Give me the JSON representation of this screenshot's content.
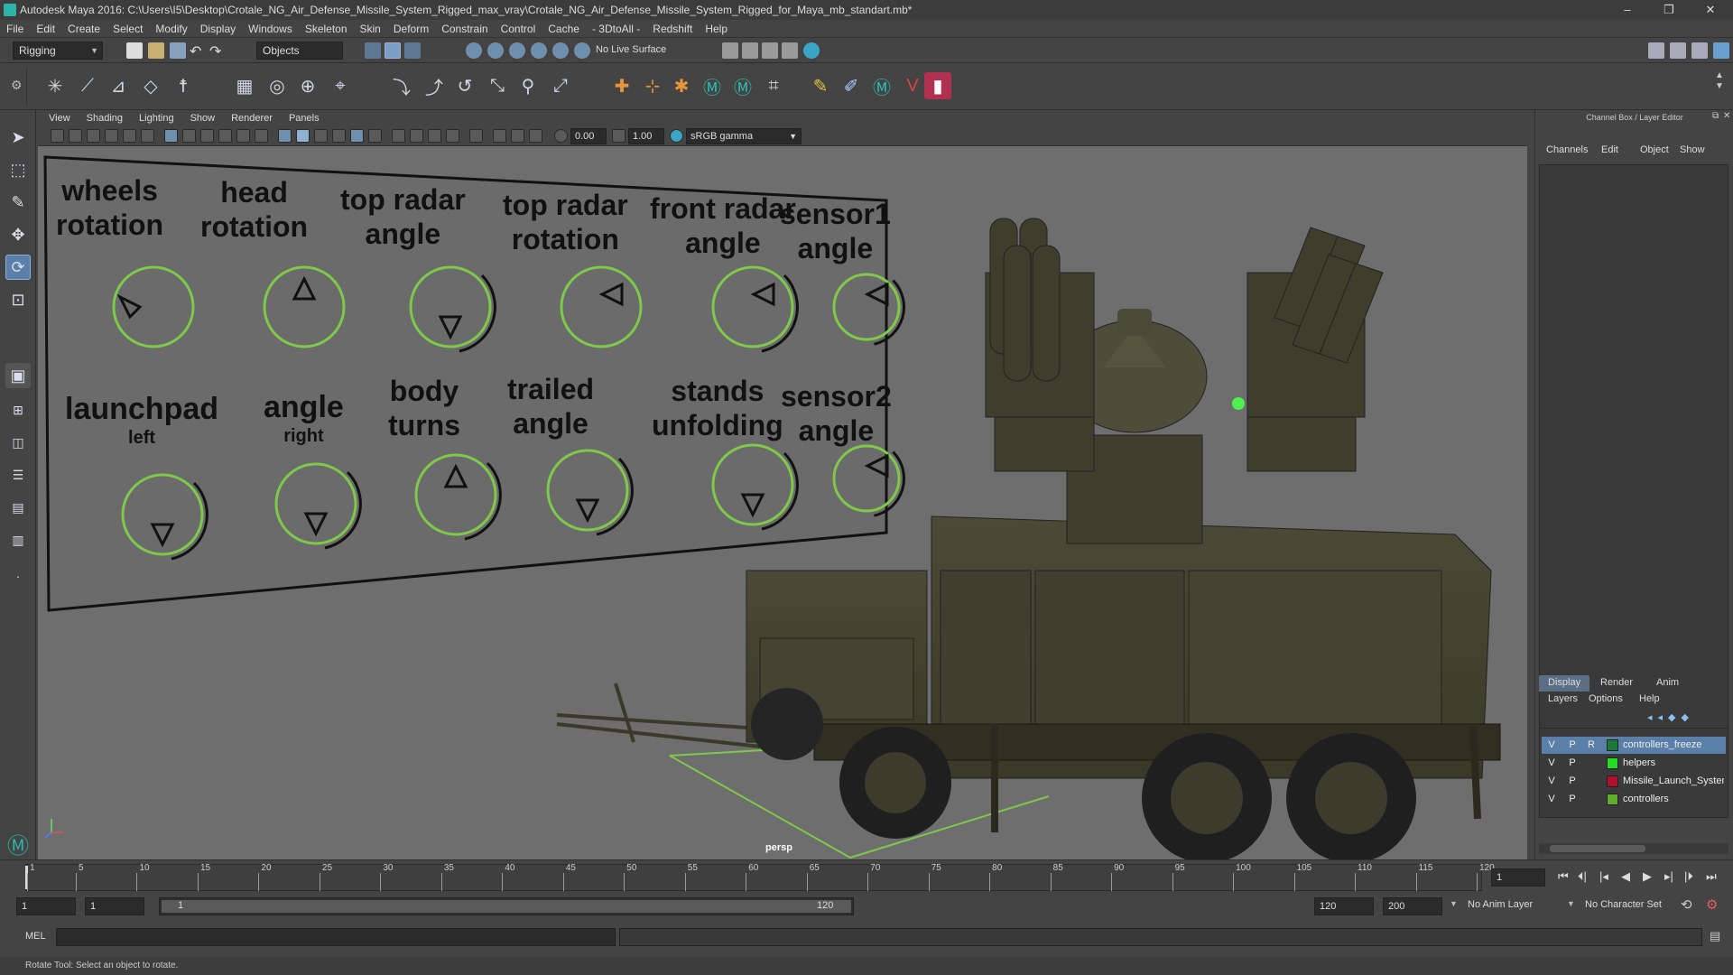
{
  "window": {
    "title": "Autodesk Maya 2016: C:\\Users\\I5\\Desktop\\Crotale_NG_Air_Defense_Missile_System_Rigged_max_vray\\Crotale_NG_Air_Defense_Missile_System_Rigged_for_Maya_mb_standart.mb*",
    "minimize": "–",
    "maximize": "❐",
    "close": "✕"
  },
  "menubar": [
    "File",
    "Edit",
    "Create",
    "Select",
    "Modify",
    "Display",
    "Windows",
    "Skeleton",
    "Skin",
    "Deform",
    "Constrain",
    "Control",
    "Cache",
    "- 3DtoAll -",
    "Redshift",
    "Help"
  ],
  "statusline": {
    "menuset": "Rigging",
    "selection_mode": "Objects",
    "live_surface": "No Live Surface"
  },
  "panel": {
    "menus": [
      "View",
      "Shading",
      "Lighting",
      "Show",
      "Renderer",
      "Panels"
    ],
    "exposure": "0.00",
    "gamma": "1.00",
    "colorspace": "sRGB gamma",
    "camera_label": "persp"
  },
  "control_board": {
    "labels": [
      {
        "text": "wheels",
        "key": "wheels"
      },
      {
        "text": "rotation",
        "key": "wheels2"
      }
    ],
    "top_row": [
      {
        "line1": "wheels",
        "line2": "rotation"
      },
      {
        "line1": "head",
        "line2": "rotation"
      },
      {
        "line1": "top radar",
        "line2": "angle"
      },
      {
        "line1": "top radar",
        "line2": "rotation"
      },
      {
        "line1": "front radar",
        "line2": "angle"
      },
      {
        "line1": "sensor1",
        "line2": "angle"
      }
    ],
    "bottom_row": [
      {
        "line1": "launchpad",
        "line2": "left"
      },
      {
        "line1": "angle",
        "line2": "right"
      },
      {
        "line1": "body",
        "line2": "turns"
      },
      {
        "line1": "trailed",
        "line2": "angle"
      },
      {
        "line1": "stands",
        "line2": "unfolding"
      },
      {
        "line1": "sensor2",
        "line2": "angle"
      }
    ]
  },
  "right_panel": {
    "header": "Channel Box / Layer Editor",
    "channel_menus": [
      "Channels",
      "Edit",
      "Object",
      "Show"
    ],
    "tabs": [
      "Display",
      "Render",
      "Anim"
    ],
    "layer_menus": [
      "Layers",
      "Options",
      "Help"
    ],
    "layers": [
      {
        "v": "V",
        "p": "P",
        "r": "R",
        "color": "#1a7a3a",
        "name": "controllers_freeze",
        "selected": true
      },
      {
        "v": "V",
        "p": "P",
        "r": "",
        "color": "#22dd22",
        "name": "helpers",
        "selected": false
      },
      {
        "v": "V",
        "p": "P",
        "r": "",
        "color": "#b01030",
        "name": "Missile_Launch_System",
        "selected": false
      },
      {
        "v": "V",
        "p": "P",
        "r": "",
        "color": "#5fae2a",
        "name": "controllers",
        "selected": false
      }
    ]
  },
  "timeline": {
    "ticks": [
      "1",
      "5",
      "10",
      "15",
      "20",
      "25",
      "30",
      "35",
      "40",
      "45",
      "50",
      "55",
      "60",
      "65",
      "70",
      "75",
      "80",
      "85",
      "90",
      "95",
      "100",
      "105",
      "110",
      "115",
      "120"
    ],
    "current_frame": "1"
  },
  "range": {
    "start": "1",
    "inner_start": "1",
    "slider_start": "1",
    "slider_end": "120",
    "end": "120",
    "outer_end": "200",
    "anim_layer": "No Anim Layer",
    "character_set": "No Character Set"
  },
  "mel": {
    "label": "MEL"
  },
  "help_line": "Rotate Tool: Select an object to rotate."
}
